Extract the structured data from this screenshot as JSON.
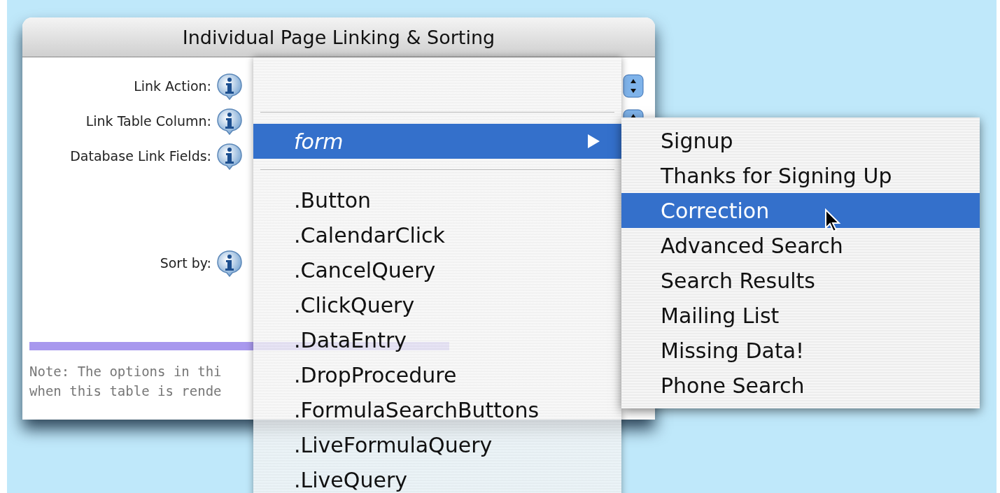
{
  "window": {
    "title": "Individual Page Linking & Sorting"
  },
  "fields": [
    {
      "label": "Link Action:",
      "popup": true
    },
    {
      "label": "Link Table Column:",
      "popup": true
    },
    {
      "label": "Database Link Fields:",
      "popup": false
    },
    {
      "label": "Sort by:",
      "popup": false
    }
  ],
  "note_lines": [
    "Note: The options in thi",
    "when this table is rende"
  ],
  "menu": {
    "items": [
      {
        "kind": "submenu",
        "label": "form",
        "selected": true
      },
      {
        "kind": "separator"
      },
      {
        "kind": "item",
        "label": ".Button",
        "selected": false
      },
      {
        "kind": "item",
        "label": ".CalendarClick",
        "selected": false
      },
      {
        "kind": "item",
        "label": ".CancelQuery",
        "selected": false
      },
      {
        "kind": "item",
        "label": ".ClickQuery",
        "selected": false
      },
      {
        "kind": "item",
        "label": ".DataEntry",
        "selected": false
      },
      {
        "kind": "item",
        "label": ".DropProcedure",
        "selected": false
      },
      {
        "kind": "item",
        "label": ".FormulaSearchButtons",
        "selected": false
      },
      {
        "kind": "item",
        "label": ".LiveFormulaQuery",
        "selected": false
      },
      {
        "kind": "item",
        "label": ".LiveQuery",
        "selected": false
      }
    ]
  },
  "submenu": {
    "items": [
      {
        "label": "Signup",
        "selected": false
      },
      {
        "label": "Thanks for Signing Up",
        "selected": false
      },
      {
        "label": "Correction",
        "selected": true
      },
      {
        "label": "Advanced Search",
        "selected": false
      },
      {
        "label": "Search Results",
        "selected": false
      },
      {
        "label": "Mailing List",
        "selected": false
      },
      {
        "label": "Missing Data!",
        "selected": false
      },
      {
        "label": "Phone Search",
        "selected": false
      }
    ]
  }
}
